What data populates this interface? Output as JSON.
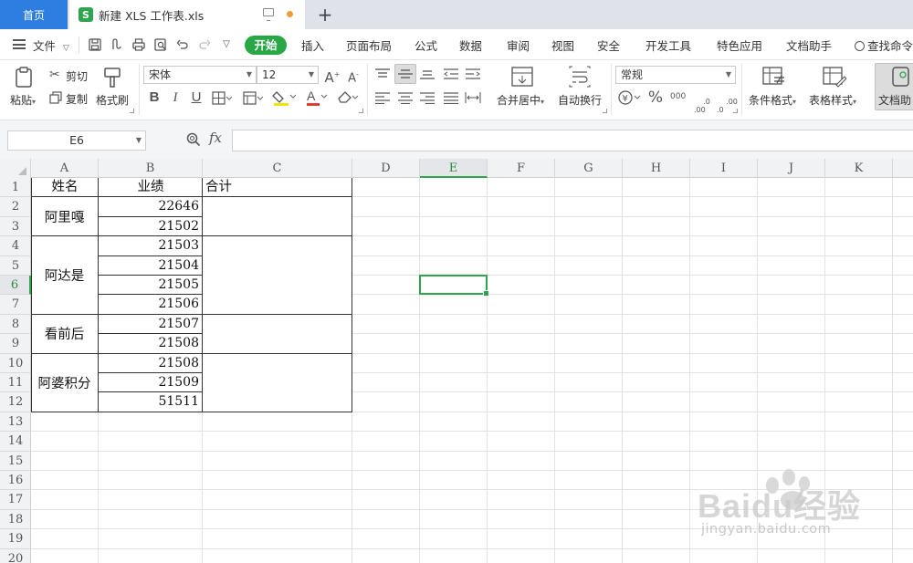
{
  "tabs": {
    "home": "首页",
    "file_title": "新建 XLS 工作表.xls",
    "file_logo": "S",
    "add": "+"
  },
  "menu": {
    "file": "文件",
    "items": [
      "开始",
      "插入",
      "页面布局",
      "公式",
      "数据",
      "审阅",
      "视图",
      "安全",
      "开发工具",
      "特色应用",
      "文档助手"
    ],
    "search": "查找命令"
  },
  "ribbon": {
    "paste": "粘贴",
    "cut": "剪切",
    "copy": "复制",
    "format_painter": "格式刷",
    "font_name": "宋体",
    "font_size": "12",
    "bold": "B",
    "italic": "I",
    "underline": "U",
    "merge_center": "合并居中",
    "wrap_text": "自动换行",
    "number_format": "常规",
    "percent": "%",
    "thousands": "000",
    "dec_inc": ".0\n.00",
    "dec_dec": ".00\n.0",
    "conditional_format": "条件格式",
    "table_style": "表格样式",
    "doc_assistant": "文档助"
  },
  "formula": {
    "cell_ref": "E6",
    "fx": "fx",
    "value": ""
  },
  "sheet": {
    "columns": [
      "A",
      "B",
      "C",
      "D",
      "E",
      "F",
      "G",
      "H",
      "I",
      "J",
      "K"
    ],
    "rows": [
      "1",
      "2",
      "3",
      "4",
      "5",
      "6",
      "7",
      "8",
      "9",
      "10",
      "11",
      "12",
      "13",
      "14",
      "15",
      "16",
      "17",
      "18",
      "19",
      "20"
    ],
    "active_column": "E",
    "active_row": "6",
    "headers": {
      "name": "姓名",
      "score": "业绩",
      "total": "合计"
    },
    "groups": [
      {
        "name": "阿里嘎",
        "values": [
          "22646",
          "21502"
        ]
      },
      {
        "name": "阿达是",
        "values": [
          "21503",
          "21504",
          "21505",
          "21506"
        ]
      },
      {
        "name": "看前后",
        "values": [
          "21507",
          "21508"
        ]
      },
      {
        "name": "阿婆积分",
        "values": [
          "21508",
          "21509",
          "51511"
        ]
      }
    ]
  },
  "watermark": {
    "brand": "Baidu经验",
    "url": "jingyan.baidu.com"
  },
  "colors": {
    "accent_green": "#2ea44f",
    "tab_blue": "#2e7de1"
  }
}
